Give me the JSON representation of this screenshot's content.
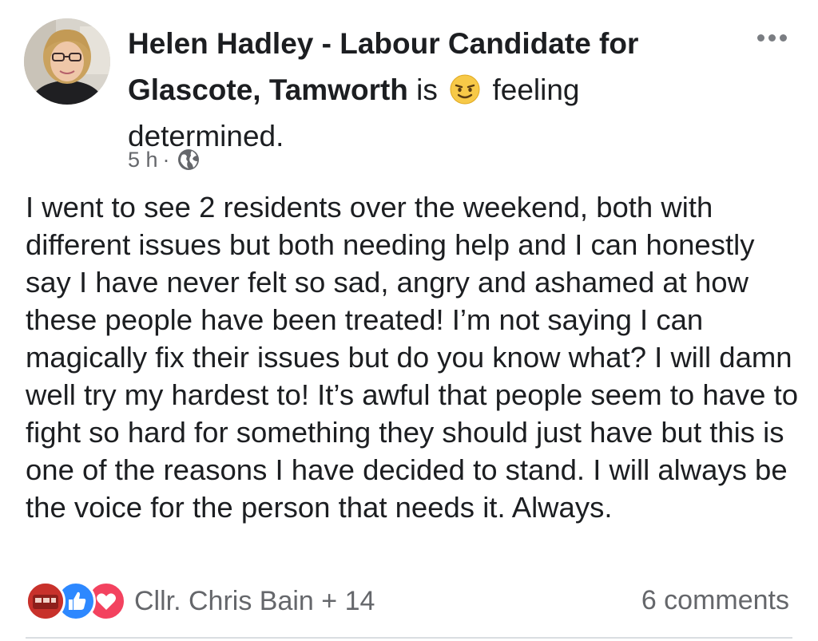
{
  "post": {
    "author": "Helen Hadley - Labour Candidate for Glascote, Tamworth",
    "feeling_prefix": "is",
    "feeling_text": "feeling determined.",
    "timestamp": "5 h",
    "separator": "·",
    "body": "I went to see 2 residents over the weekend, both with different issues but both needing help and I can honestly say I have never felt so sad, angry and ashamed at how these people have been treated! I’m not saying I can magically fix their issues but do you know what? I will damn well try my hardest to! It’s awful that people seem to have to fight so hard for something they should just have but this is one of the reasons I have decided to stand. I will always be the voice for the person that needs it. Always.",
    "reactions_label": "Cllr. Chris Bain + 14",
    "comments_label": "6 comments"
  },
  "icons": {
    "more": "more-options-icon",
    "feeling": "determined-emoji-icon",
    "audience": "globe-icon",
    "like": "like-reaction-icon",
    "love": "love-reaction-icon"
  },
  "colors": {
    "text": "#1c1e21",
    "secondary": "#65676b",
    "like": "#2d88ff",
    "love": "#f3425f"
  }
}
